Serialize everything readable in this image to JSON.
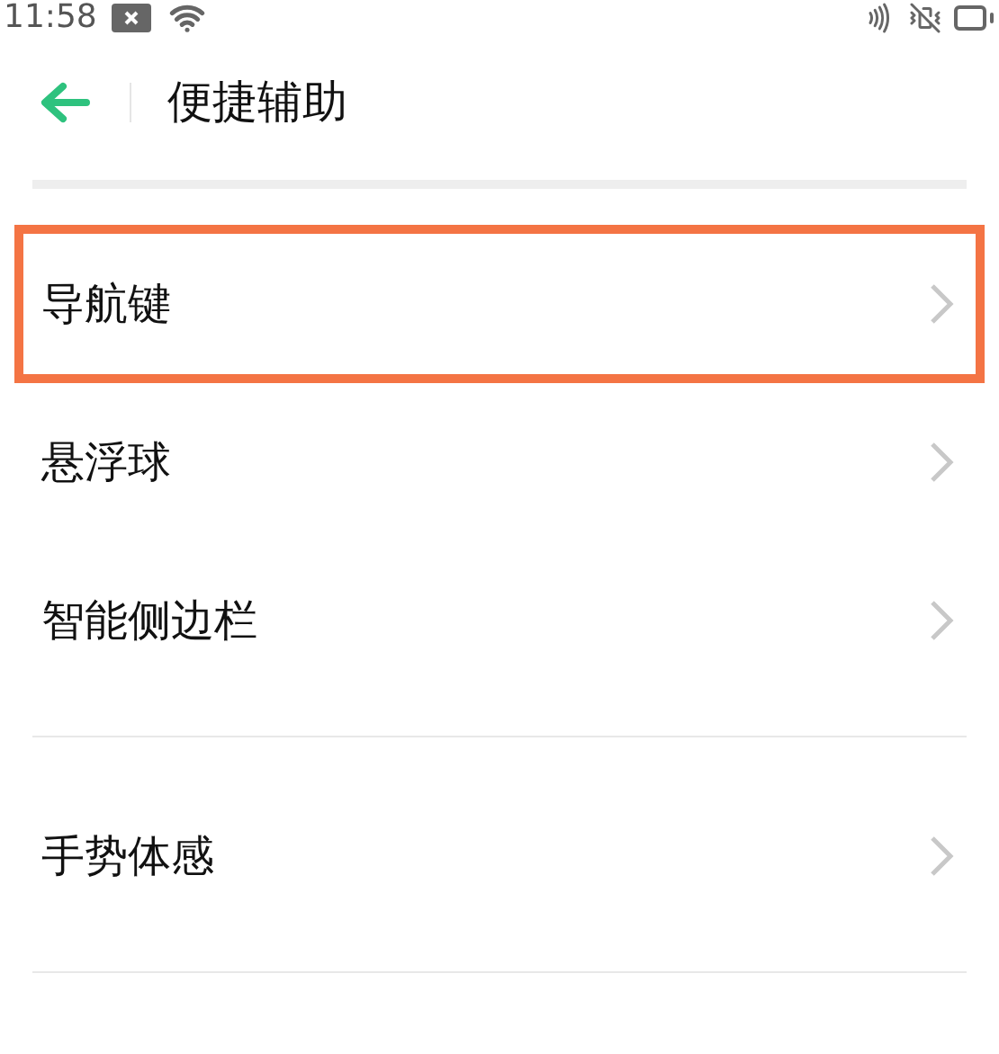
{
  "status_bar": {
    "time": "11:58"
  },
  "header": {
    "title": "便捷辅助"
  },
  "groups": [
    {
      "items": [
        {
          "label": "导航键",
          "highlighted": true
        },
        {
          "label": "悬浮球",
          "highlighted": false
        },
        {
          "label": "智能侧边栏",
          "highlighted": false
        }
      ]
    },
    {
      "items": [
        {
          "label": "手势体感",
          "highlighted": false
        }
      ]
    }
  ]
}
